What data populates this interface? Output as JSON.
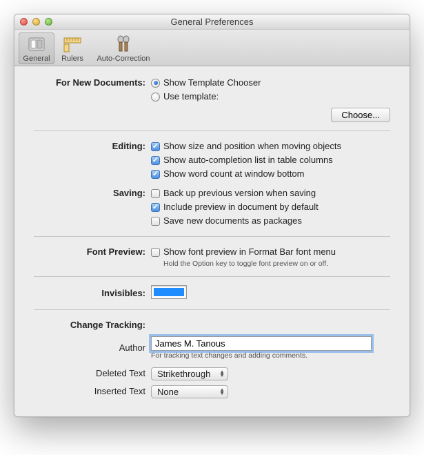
{
  "window": {
    "title": "General Preferences"
  },
  "toolbar": {
    "general": "General",
    "rulers": "Rulers",
    "autocorrection": "Auto-Correction"
  },
  "newDocs": {
    "label": "For New Documents:",
    "opt1": "Show Template Chooser",
    "opt2": "Use template:",
    "choose": "Choose..."
  },
  "editing": {
    "label": "Editing:",
    "c1": "Show size and position when moving objects",
    "c2": "Show auto-completion list in table columns",
    "c3": "Show word count at window bottom"
  },
  "saving": {
    "label": "Saving:",
    "c1": "Back up previous version when saving",
    "c2": "Include preview in document by default",
    "c3": "Save new documents as packages"
  },
  "fontPreview": {
    "label": "Font Preview:",
    "c1": "Show font preview in Format Bar font menu",
    "hint": "Hold the Option key to toggle font preview on or off."
  },
  "invisibles": {
    "label": "Invisibles:",
    "color": "#1f8cff"
  },
  "changeTracking": {
    "label": "Change Tracking:",
    "authorLabel": "Author",
    "author": "James M. Tanous",
    "authorHint": "For tracking text changes and adding comments.",
    "deletedLabel": "Deleted Text",
    "deletedValue": "Strikethrough",
    "insertedLabel": "Inserted Text",
    "insertedValue": "None"
  }
}
